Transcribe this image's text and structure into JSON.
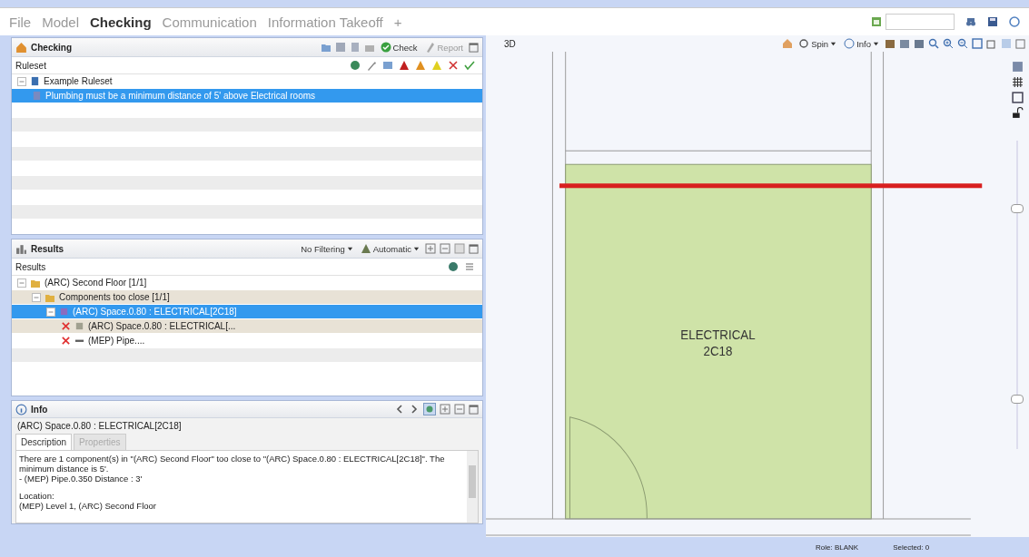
{
  "menu": [
    {
      "label": "File",
      "selected": false
    },
    {
      "label": "Model",
      "selected": false
    },
    {
      "label": "Checking",
      "selected": true
    },
    {
      "label": "Communication",
      "selected": false
    },
    {
      "label": "Information Takeoff",
      "selected": false
    }
  ],
  "menu_add": "+",
  "checking": {
    "title": "Checking",
    "check_button": "Check",
    "report_button": "Report",
    "column": "Ruleset",
    "tree": [
      {
        "label": "Example Ruleset",
        "kind": "ruleset",
        "selected": false,
        "expanded": true,
        "children": [
          {
            "label": "Plumbing must be a minimum distance of 5' above Electrical rooms",
            "kind": "rule",
            "selected": true
          }
        ]
      }
    ]
  },
  "results": {
    "title": "Results",
    "filter": "No Filtering",
    "mode": "Automatic",
    "column": "Results",
    "tree": [
      {
        "label": "(ARC) Second Floor [1/1]",
        "kind": "floor",
        "selected": false,
        "expanded": true,
        "children": [
          {
            "label": "Components too close [1/1]",
            "kind": "group",
            "selected": false,
            "expanded": true,
            "children": [
              {
                "label": "(ARC) Space.0.80 : ELECTRICAL[2C18]",
                "kind": "space",
                "selected": true,
                "expanded": true,
                "children": [
                  {
                    "label": "(ARC) Space.0.80 : ELECTRICAL[...",
                    "kind": "clash-space",
                    "selected": false
                  },
                  {
                    "label": "(MEP) Pipe....",
                    "kind": "clash-pipe",
                    "selected": false
                  }
                ]
              }
            ]
          }
        ]
      }
    ]
  },
  "info": {
    "title": "Info",
    "subject": "(ARC) Space.0.80 : ELECTRICAL[2C18]",
    "tabs": [
      {
        "label": "Description",
        "selected": true
      },
      {
        "label": "Properties",
        "selected": false
      }
    ],
    "description": [
      [
        "There are 1 component(s) in \"(ARC) Second Floor\" too close to \"(ARC) Space.0.80 : ELECTRICAL[2C18]\". The minimum distance is 5'.",
        "- (MEP) Pipe.0.350 Distance : 3'"
      ],
      [
        "Location:",
        "(MEP) Level 1, (ARC) Second Floor"
      ]
    ]
  },
  "view": {
    "title": "3D",
    "spin_button": "Spin",
    "info_button": "Info",
    "room_name": "ELECTRICAL",
    "room_number": "2C18"
  },
  "status_bar": {
    "role": "Role: BLANK",
    "selected": "Selected: 0"
  }
}
